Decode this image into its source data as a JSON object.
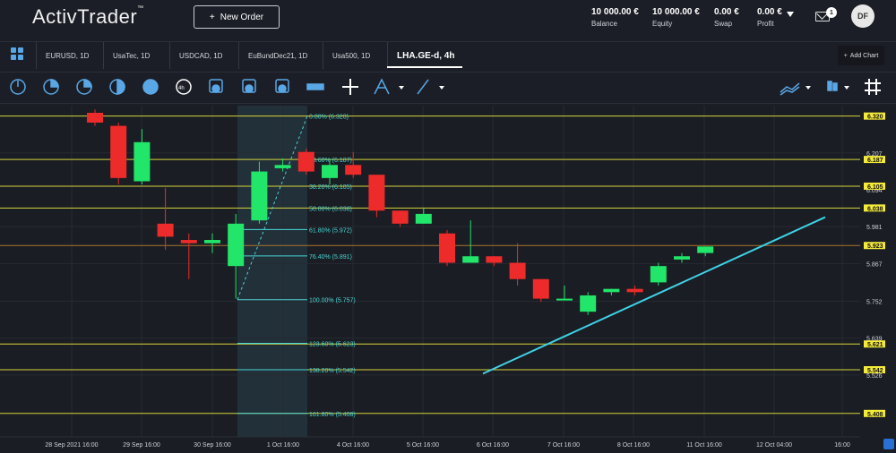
{
  "app": {
    "title_main": "ActivTrader",
    "title_tm": "™"
  },
  "header": {
    "new_order_label": "New Order",
    "stats": [
      {
        "value": "10 000.00 €",
        "label": "Balance"
      },
      {
        "value": "10 000.00 €",
        "label": "Equity"
      },
      {
        "value": "0.00 €",
        "label": "Swap"
      },
      {
        "value": "0.00 €",
        "label": "Profit"
      }
    ],
    "notifications": "1",
    "user_initials": "DF"
  },
  "tabs": [
    {
      "label": "EURUSD, 1D"
    },
    {
      "label": "UsaTec, 1D"
    },
    {
      "label": "USDCAD, 1D"
    },
    {
      "label": "EuBundDec21, 1D"
    },
    {
      "label": "Usa500, 1D"
    },
    {
      "label": "LHA.GE-d, 4h",
      "active": true
    }
  ],
  "add_chart_label": "Add Chart",
  "toolbar_icons": [
    "clock-icon",
    "clock-half-icon",
    "clock-quarter-icon",
    "moon-icon",
    "hour-icon",
    "4h-icon",
    "day-icon",
    "week-icon",
    "month-icon",
    "ruler-icon",
    "crosshair-icon",
    "pitchfork-icon",
    "trendline-icon",
    "indicators-icon",
    "candle-type-icon",
    "grid-icon"
  ],
  "chart_data": {
    "type": "candlestick",
    "symbol": "LHA.GE-d, 4h",
    "ylim": [
      5.38,
      6.33
    ],
    "x_ticks": [
      "28 Sep 2021 16:00",
      "29 Sep 16:00",
      "30 Sep 16:00",
      "1 Oct 16:00",
      "4 Oct 16:00",
      "5 Oct 16:00",
      "6 Oct 16:00",
      "7 Oct 16:00",
      "8 Oct 16:00",
      "11 Oct 16:00",
      "12 Oct 04:00",
      "16:00"
    ],
    "y_ticks": [
      "6.207",
      "5.981",
      "5.867",
      "5.752",
      "5.639",
      "5.526"
    ],
    "price_tags": [
      {
        "value": 6.32,
        "label": "6.320"
      },
      {
        "value": 6.187,
        "label": "6.187"
      },
      {
        "value": 6.105,
        "label": "6.105"
      },
      {
        "value": 6.038,
        "label": "6.038"
      },
      {
        "value": 5.923,
        "label": "5.923"
      },
      {
        "value": 5.621,
        "label": "5.621"
      },
      {
        "value": 5.542,
        "label": "5.542"
      },
      {
        "value": 5.408,
        "label": "5.408"
      }
    ],
    "extra_axis_label": {
      "value": 6.094,
      "label": "6.094"
    },
    "fib_levels": [
      {
        "value": 6.32,
        "label": "0.00% (6.320)"
      },
      {
        "value": 6.187,
        "label": "23.60% (6.187)"
      },
      {
        "value": 6.105,
        "label": "38.20% (6.105)"
      },
      {
        "value": 6.038,
        "label": "50.00% (6.038)"
      },
      {
        "value": 5.972,
        "label": "61.80% (5.972)"
      },
      {
        "value": 5.891,
        "label": "76.40% (5.891)"
      },
      {
        "value": 5.757,
        "label": "100.00% (5.757)"
      },
      {
        "value": 5.623,
        "label": "123.60% (5.623)"
      },
      {
        "value": 5.542,
        "label": "138.20% (5.542)"
      },
      {
        "value": 5.408,
        "label": "161.80% (5.408)"
      }
    ],
    "current_price": 5.923,
    "candles": [
      {
        "o": 6.33,
        "h": 6.34,
        "l": 6.29,
        "c": 6.3
      },
      {
        "o": 6.29,
        "h": 6.3,
        "l": 6.11,
        "c": 6.13
      },
      {
        "o": 6.12,
        "h": 6.28,
        "l": 6.11,
        "c": 6.24
      },
      {
        "o": 5.99,
        "h": 6.1,
        "l": 5.91,
        "c": 5.95
      },
      {
        "o": 5.94,
        "h": 5.96,
        "l": 5.82,
        "c": 5.93
      },
      {
        "o": 5.93,
        "h": 5.96,
        "l": 5.9,
        "c": 5.94
      },
      {
        "o": 5.86,
        "h": 6.02,
        "l": 5.76,
        "c": 5.99
      },
      {
        "o": 6.0,
        "h": 6.18,
        "l": 5.99,
        "c": 6.15
      },
      {
        "o": 6.16,
        "h": 6.19,
        "l": 6.15,
        "c": 6.17
      },
      {
        "o": 6.21,
        "h": 6.22,
        "l": 6.14,
        "c": 6.15
      },
      {
        "o": 6.13,
        "h": 6.19,
        "l": 6.11,
        "c": 6.17
      },
      {
        "o": 6.17,
        "h": 6.21,
        "l": 6.13,
        "c": 6.14
      },
      {
        "o": 6.14,
        "h": 6.14,
        "l": 6.01,
        "c": 6.03
      },
      {
        "o": 6.03,
        "h": 6.03,
        "l": 5.98,
        "c": 5.99
      },
      {
        "o": 5.99,
        "h": 6.04,
        "l": 5.99,
        "c": 6.02
      },
      {
        "o": 5.96,
        "h": 5.97,
        "l": 5.86,
        "c": 5.87
      },
      {
        "o": 5.87,
        "h": 6.0,
        "l": 5.87,
        "c": 5.89
      },
      {
        "o": 5.89,
        "h": 5.89,
        "l": 5.86,
        "c": 5.87
      },
      {
        "o": 5.87,
        "h": 5.93,
        "l": 5.8,
        "c": 5.82
      },
      {
        "o": 5.82,
        "h": 5.82,
        "l": 5.75,
        "c": 5.76
      },
      {
        "o": 5.76,
        "h": 5.8,
        "l": 5.76,
        "c": 5.76
      },
      {
        "o": 5.72,
        "h": 5.78,
        "l": 5.71,
        "c": 5.77
      },
      {
        "o": 5.78,
        "h": 5.79,
        "l": 5.77,
        "c": 5.79
      },
      {
        "o": 5.79,
        "h": 5.8,
        "l": 5.77,
        "c": 5.78
      },
      {
        "o": 5.81,
        "h": 5.87,
        "l": 5.8,
        "c": 5.86
      },
      {
        "o": 5.88,
        "h": 5.9,
        "l": 5.87,
        "c": 5.89
      },
      {
        "o": 5.9,
        "h": 5.92,
        "l": 5.89,
        "c": 5.92
      }
    ]
  }
}
